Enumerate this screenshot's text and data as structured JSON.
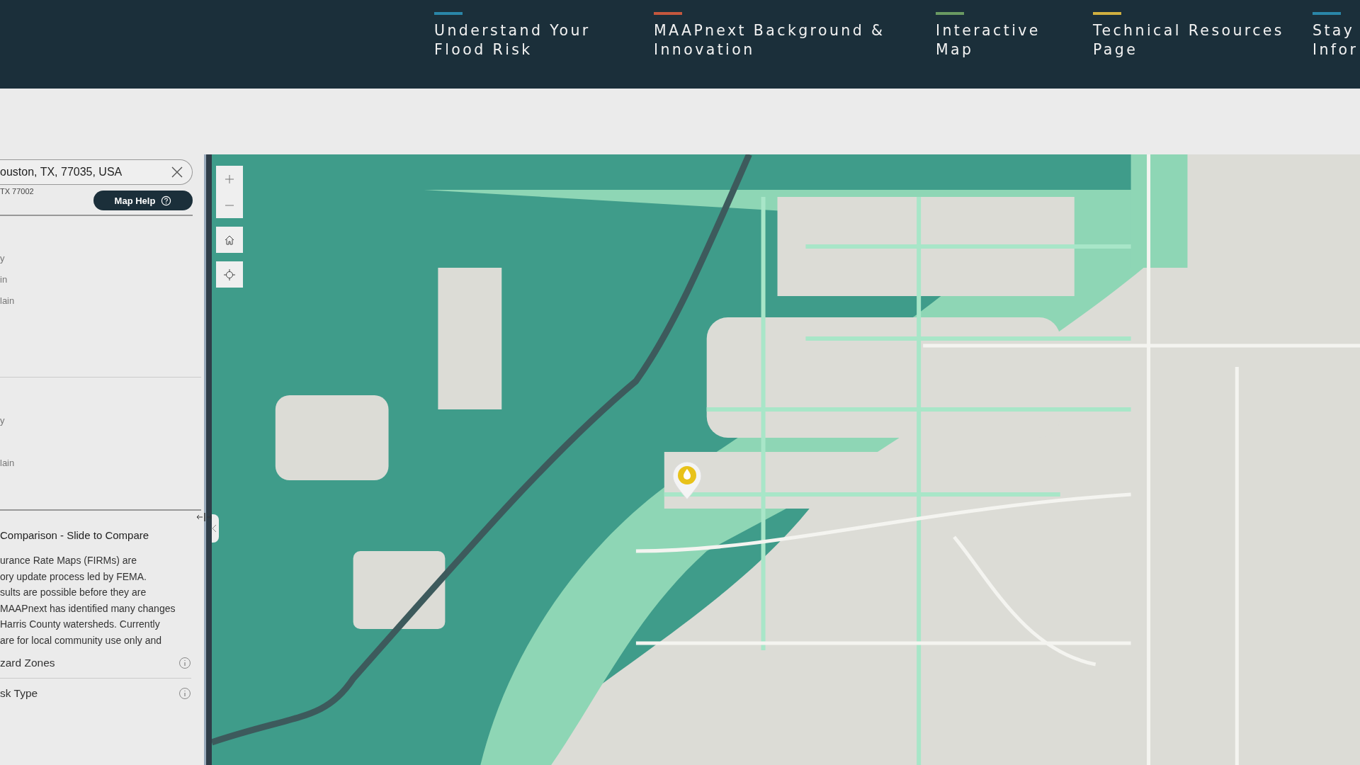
{
  "nav": {
    "items": [
      {
        "lines": [
          "Understand Your",
          "Flood Risk"
        ],
        "color": "#2a86a8"
      },
      {
        "lines": [
          "MAAPnext Background &",
          "Innovation"
        ],
        "color": "#c4573d"
      },
      {
        "lines": [
          "Interactive",
          "Map"
        ],
        "color": "#6a9a62"
      },
      {
        "lines": [
          "Technical Resources",
          "Page"
        ],
        "color": "#d0b040"
      },
      {
        "lines": [
          "Stay",
          "Infor"
        ],
        "color": "#2a86a8"
      }
    ]
  },
  "panel": {
    "search": {
      "value": "ouston, TX, 77035, USA"
    },
    "address_hint": "TX 77002",
    "help_button": "Map Help",
    "group_1": [
      "y",
      "in",
      "lain"
    ],
    "group_2": [
      "y",
      "lain"
    ],
    "comparison_title": "Comparison - Slide to Compare",
    "comparison_text": [
      "urance Rate Maps (FIRMs) are",
      "ory update process led by FEMA.",
      "sults are possible before they are",
      "MAAPnext has identified many changes",
      "Harris County watersheds. Currently",
      "are for local community use only and"
    ],
    "layers": [
      "zard Zones",
      "sk Type"
    ]
  }
}
